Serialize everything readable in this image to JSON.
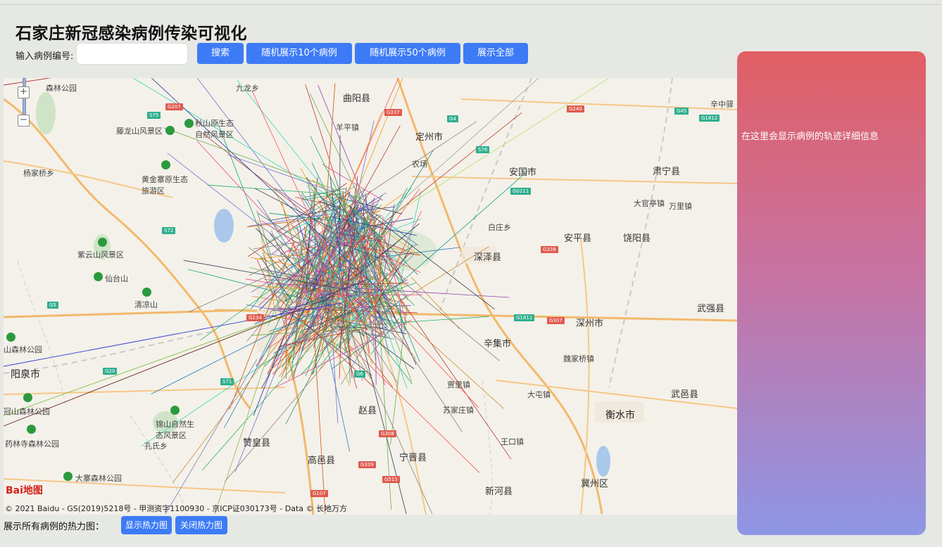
{
  "title": "石家庄新冠感染病例传染可视化",
  "search": {
    "label": "输入病例编号:",
    "value": "",
    "placeholder": ""
  },
  "buttons": {
    "search": "搜索",
    "random10": "随机展示10个病例",
    "random50": "随机展示50个病例",
    "show_all": "展示全部"
  },
  "panel": {
    "text": "在这里会显示病例的轨迹详细信息"
  },
  "heatmap": {
    "label": "展示所有病例的热力图：",
    "show_button": "显示热力图",
    "close_button": "关闭热力图"
  },
  "map": {
    "copyright": "© 2021 Baidu - GS(2019)5218号 - 甲测资字1100930 - 京ICP证030173号 - Data © 长地万方",
    "logo": "Bai地图",
    "zoom_in": "+",
    "zoom_out": "−",
    "places": {
      "quyang": "曲阳县",
      "dingzhou": "定州市",
      "anguo": "安国市",
      "suning": "肃宁县",
      "anping": "安平县",
      "raoyang": "饶阳县",
      "shenze": "深泽县",
      "shenzhou": "深州市",
      "wuqiang": "武强县",
      "hengshui": "衡水市",
      "wuyi": "武邑县",
      "jizhou": "冀州区",
      "xinhe": "新河县",
      "ningjin": "宁晋县",
      "gaoyi": "高邑县",
      "zanhuang": "赞皇县",
      "yangquan": "阳泉市",
      "xinji": "辛集市",
      "zhaoxian": "赵县",
      "yangping": "羊平镇",
      "baizhuang": "白庄乡",
      "nongchang": "农场",
      "daguanting": "大官亭镇",
      "wanli": "万里镇",
      "weijiaqiao": "魏家桥镇",
      "datun": "大屯镇",
      "wangkou": "王口镇",
      "suojiazhuang": "苏家庄镇",
      "jiulong": "九龙乡",
      "yanglaqiao": "杨家桥乡",
      "kongshi": "孔氏乡",
      "zhongting": "辛中驿",
      "jinyingzi": "贾里镇",
      "tenglong": "藤龙山风景区",
      "qiushan": "秋山原生态自然风景区",
      "huangjin": "黄金寨原生态旅游区",
      "ziyun": "紫云山风景区",
      "xiantai": "仙台山",
      "qingliang": "清凉山",
      "jinshan": "锦山自然生态风景区",
      "dazhai": "大寨森林公园",
      "guanshan": "冠山森林公园",
      "yaolin": "药林寺森林公园",
      "shansenlin": "山森林公园",
      "forest_top": "森林公园"
    },
    "roads": [
      "G207",
      "G337",
      "G240",
      "G45",
      "G1812",
      "G4",
      "G5",
      "G20",
      "G307",
      "G1811",
      "G308",
      "G339",
      "G515",
      "G107",
      "G6",
      "S75",
      "S76",
      "S71",
      "S72",
      "G0211",
      "G338",
      "G234"
    ]
  },
  "colors": {
    "accent": "#3d7bf6",
    "panel_top": "#e05f64",
    "panel_bottom": "#8e96e5",
    "page_bg": "#e6e8e4"
  }
}
